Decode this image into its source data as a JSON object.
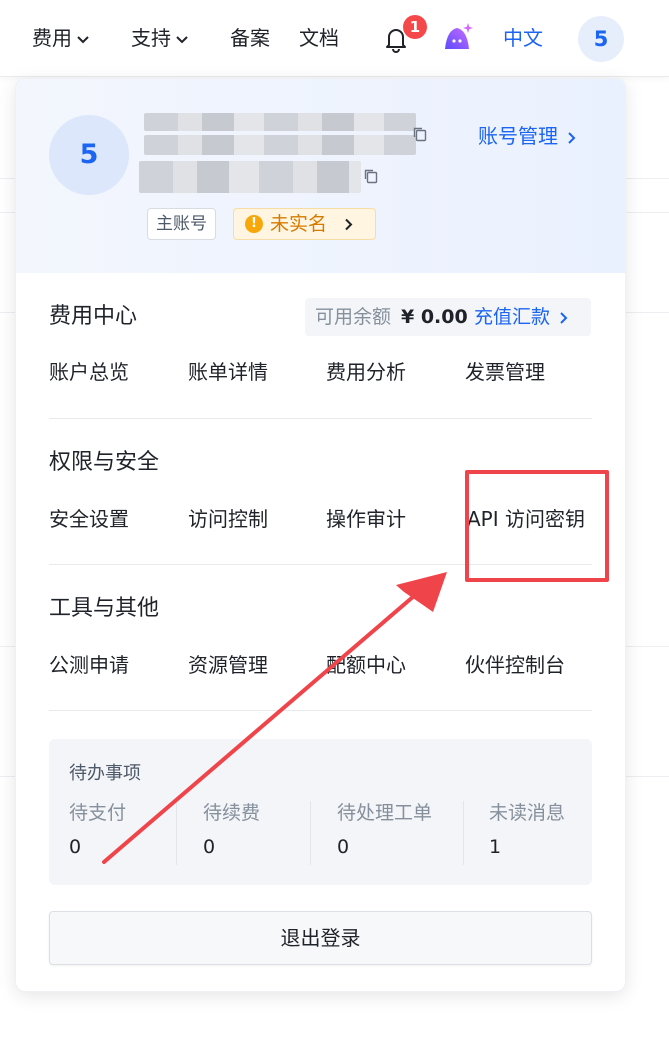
{
  "topbar": {
    "nav": [
      {
        "label": "费用",
        "has_dropdown": true,
        "icon": "chevron-down-icon"
      },
      {
        "label": "支持",
        "has_dropdown": true,
        "icon": "chevron-down-icon"
      },
      {
        "label": "备案"
      },
      {
        "label": "文档"
      }
    ],
    "notification_icon": "bell-icon",
    "notification_count": "1",
    "ai_icon": "ai-assistant-icon",
    "language": "中文",
    "avatar_text": "5"
  },
  "account": {
    "avatar_text": "5",
    "manage_label": "账号管理",
    "tag_main": "主账号",
    "tag_verify": "未实名",
    "tag_verify_icon": "warning-icon"
  },
  "billing": {
    "title": "费用中心",
    "balance_label": "可用余额",
    "balance_value": "¥ 0.00",
    "recharge_label": "充值汇款",
    "links": [
      "账户总览",
      "账单详情",
      "费用分析",
      "发票管理"
    ]
  },
  "security": {
    "title": "权限与安全",
    "links": [
      "安全设置",
      "访问控制",
      "操作审计",
      "API 访问密钥"
    ]
  },
  "tools": {
    "title": "工具与其他",
    "links": [
      "公测申请",
      "资源管理",
      "配额中心",
      "伙伴控制台"
    ]
  },
  "todo": {
    "title": "待办事项",
    "items": [
      {
        "label": "待支付",
        "value": "0"
      },
      {
        "label": "待续费",
        "value": "0"
      },
      {
        "label": "待处理工单",
        "value": "0"
      },
      {
        "label": "未读消息",
        "value": "1"
      }
    ]
  },
  "logout_label": "退出登录",
  "colors": {
    "accent": "#1c64f2",
    "annotation": "#f0444b",
    "warning": "#f7a70a"
  }
}
